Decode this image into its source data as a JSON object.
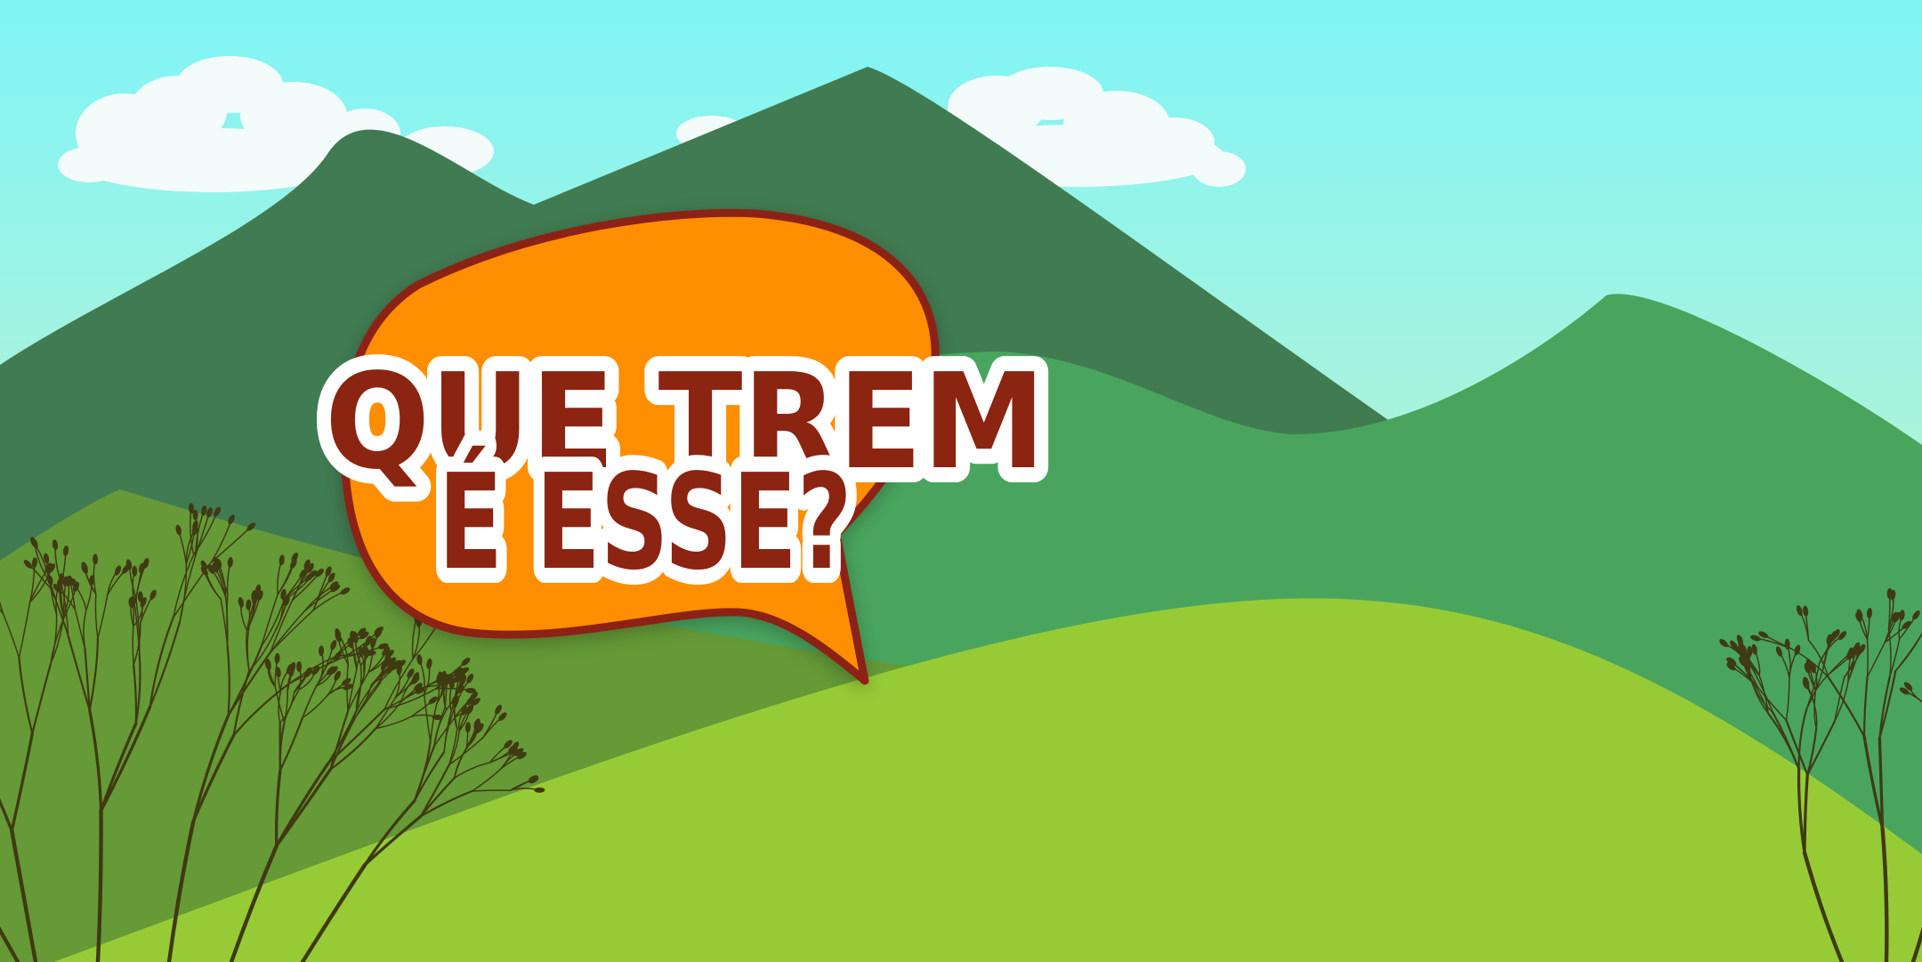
{
  "logo": {
    "line1": "QUE TREM",
    "line2": "É ESSE?"
  },
  "colors": {
    "sky_top": "#7FF5F6",
    "sky_bottom": "#E0F5C8",
    "cloud": "#F4FBFB",
    "mountain_back": "#417B51",
    "mountain_mid": "#49A55E",
    "hill_left": "#659A37",
    "hill_front": "#97CB36",
    "bubble_fill": "#FF8E04",
    "bubble_outline": "#8C2412",
    "text_fill": "#8C2412",
    "text_outline": "#FFFFFF",
    "branches": "#3F3A12"
  }
}
